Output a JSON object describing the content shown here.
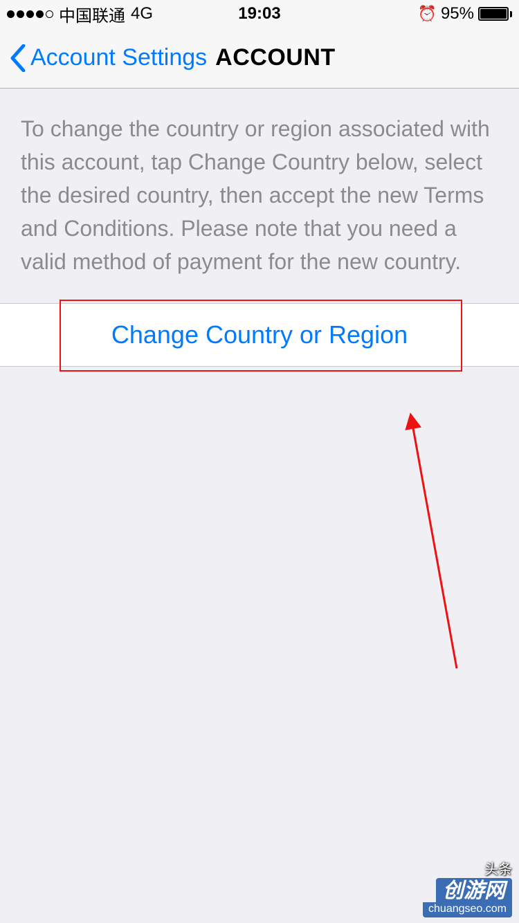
{
  "status_bar": {
    "carrier": "中国联通",
    "network": "4G",
    "time": "19:03",
    "battery_percent": "95%",
    "alarm_glyph": "⏰"
  },
  "nav": {
    "back_label": "Account Settings",
    "title": "ACCOUNT"
  },
  "description_text": "To change the country or region associated with this account, tap Change Country below, select the desired country, then accept the new Terms and Conditions. Please note that you need a valid method of payment for the new country.",
  "change_button_label": "Change Country or Region",
  "watermark": {
    "line1": "头条",
    "badge": "创游网",
    "url": "chuangseo.com"
  }
}
